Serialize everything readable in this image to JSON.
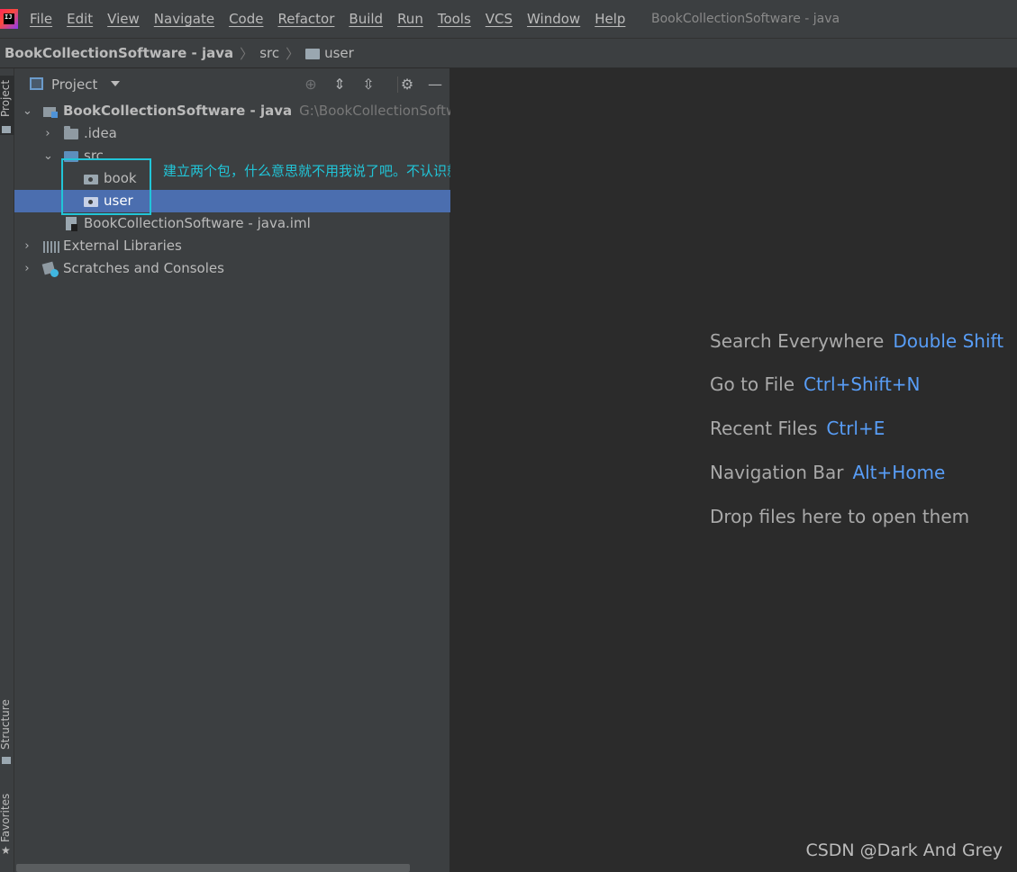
{
  "menubar": {
    "logo_text": "IJ",
    "items": [
      "File",
      "Edit",
      "View",
      "Navigate",
      "Code",
      "Refactor",
      "Build",
      "Run",
      "Tools",
      "VCS",
      "Window",
      "Help"
    ],
    "window_title": "BookCollectionSoftware - java"
  },
  "breadcrumb": {
    "project": "BookCollectionSoftware - java",
    "sep": "〉",
    "src": "src",
    "user": "user"
  },
  "tool_strip": {
    "project": "Project",
    "structure": "Structure",
    "favorites": "Favorites"
  },
  "project_panel": {
    "title": "Project",
    "tree": {
      "root_name": "BookCollectionSoftware - java",
      "root_path": "G:\\BookCollectionSoftware",
      "idea": ".idea",
      "src": "src",
      "book": "book",
      "user": "user",
      "iml": "BookCollectionSoftware - java.iml",
      "external_libraries": "External Libraries",
      "scratches": "Scratches and Consoles"
    }
  },
  "annotation": {
    "text": "建立两个包，什么意思就不用我说了吧。不认识就用手机查"
  },
  "welcome": {
    "search_label": "Search Everywhere",
    "search_key": "Double Shift",
    "goto_label": "Go to File",
    "goto_key": "Ctrl+Shift+N",
    "recent_label": "Recent Files",
    "recent_key": "Ctrl+E",
    "nav_label": "Navigation Bar",
    "nav_key": "Alt+Home",
    "drop_label": "Drop files here to open them"
  },
  "watermark": "CSDN @Dark And Grey",
  "colors": {
    "accent": "#4b6eaf",
    "annotation": "#21c5d8",
    "shortcut": "#589df6"
  }
}
